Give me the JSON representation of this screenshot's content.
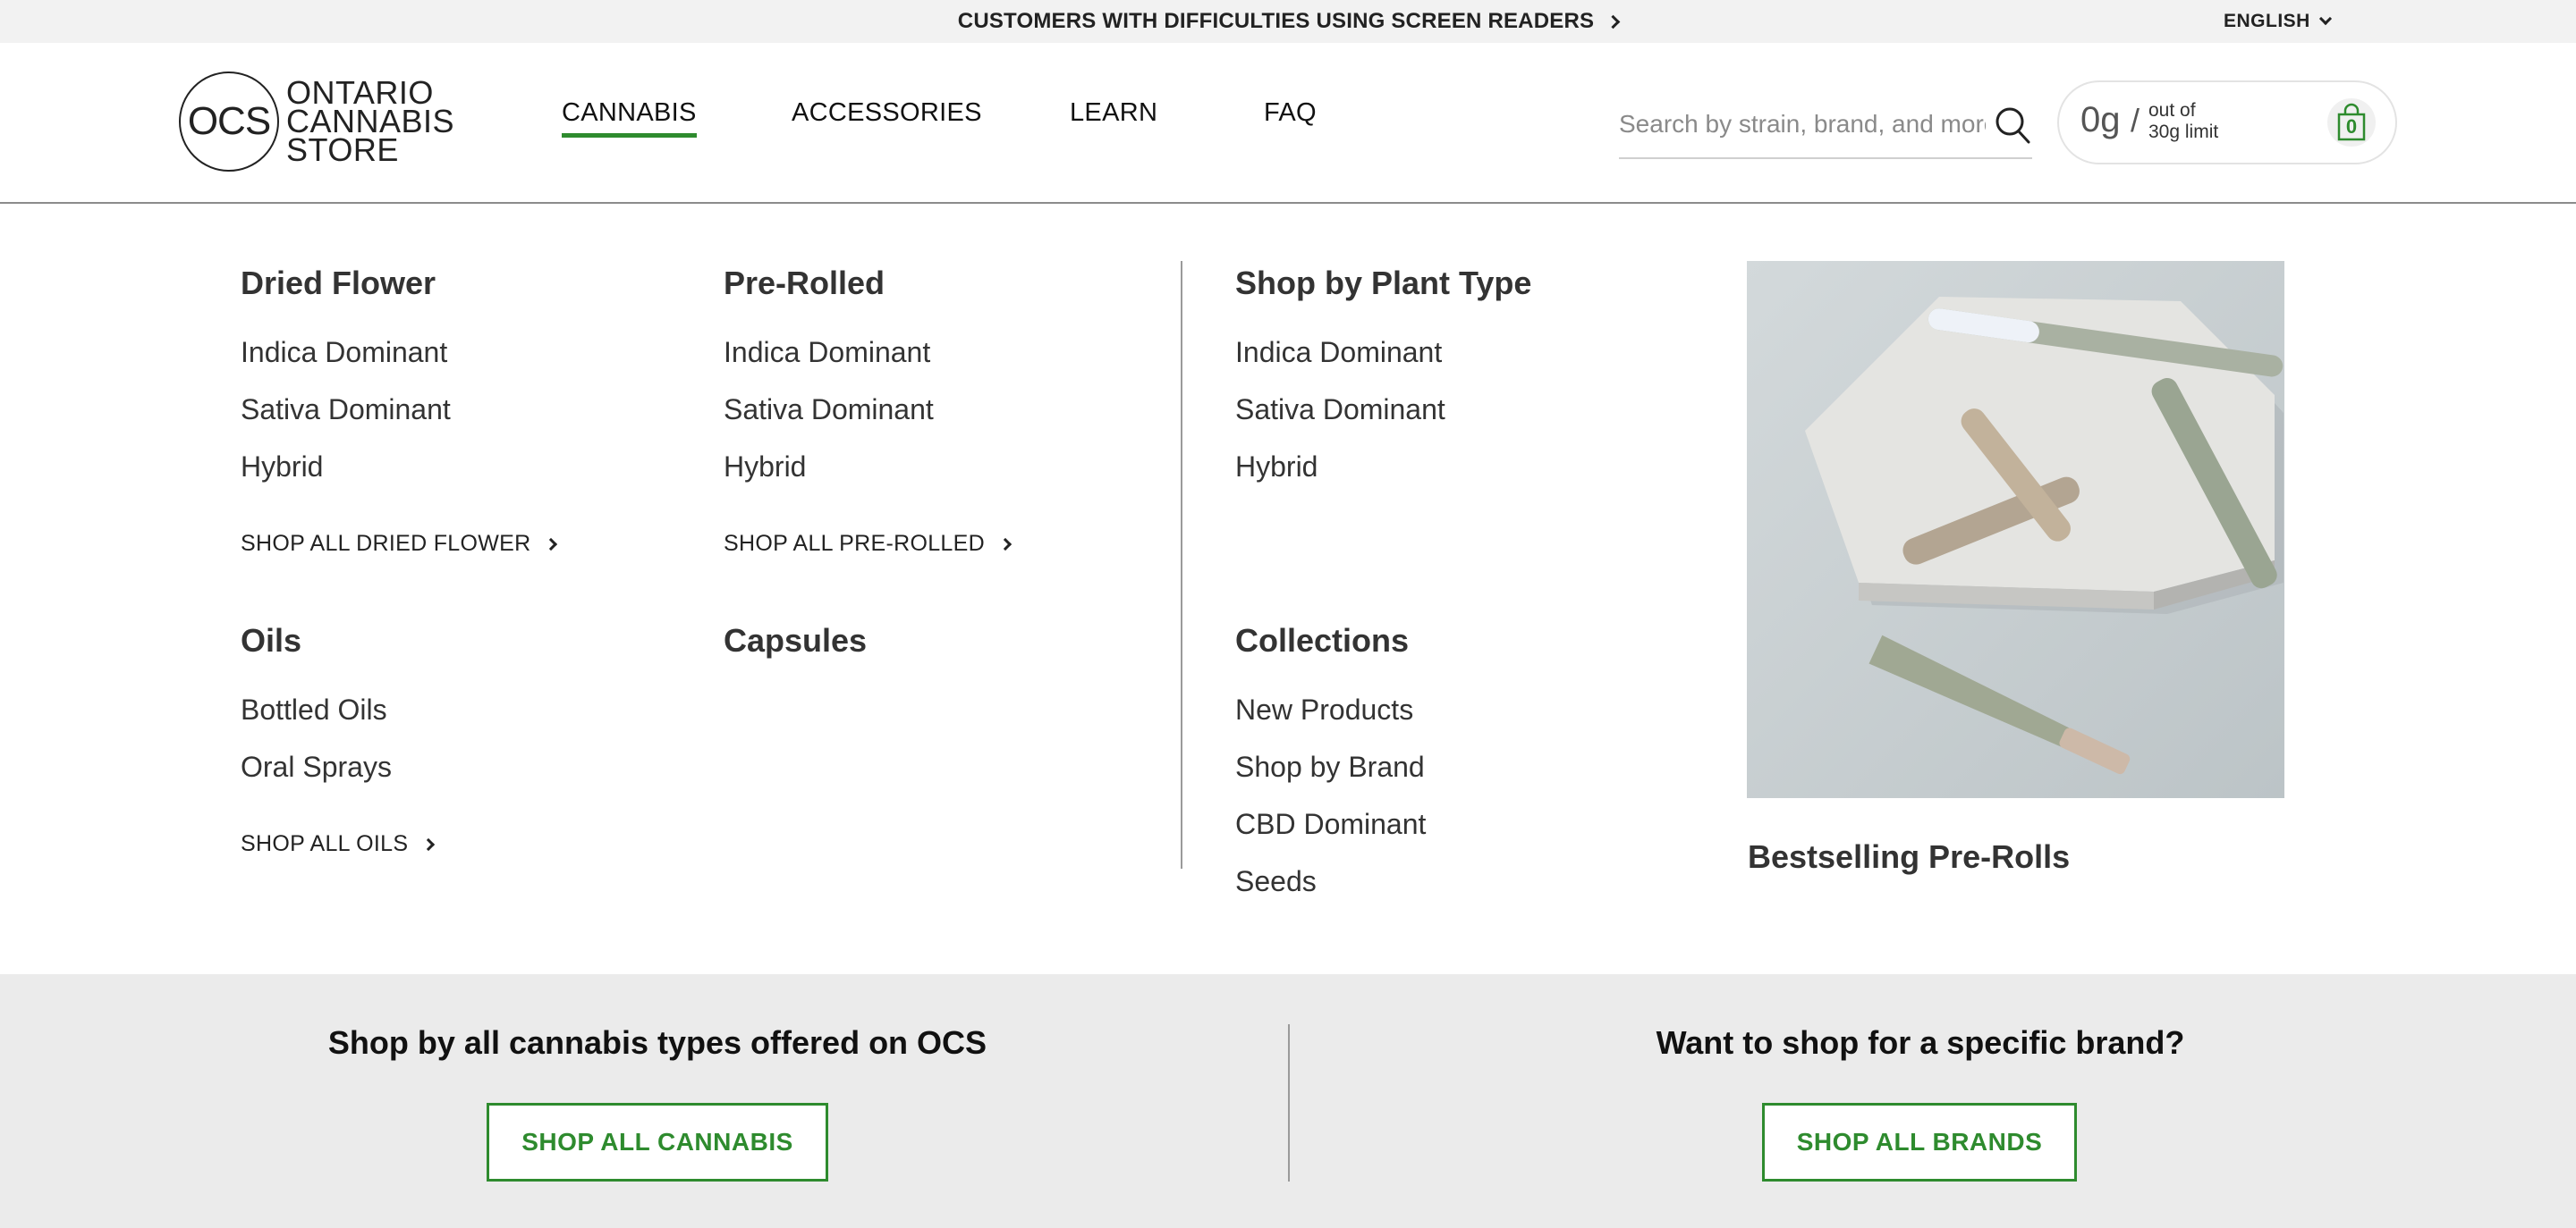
{
  "topbar": {
    "accessibility_link": "CUSTOMERS WITH DIFFICULTIES USING SCREEN READERS",
    "language": "ENGLISH"
  },
  "header": {
    "logo": {
      "monogram": "OCS",
      "line1": "ONTARIO",
      "line2": "CANNABIS",
      "line3": "STORE"
    },
    "nav": [
      {
        "label": "CANNABIS",
        "active": true
      },
      {
        "label": "ACCESSORIES",
        "active": false
      },
      {
        "label": "LEARN",
        "active": false
      },
      {
        "label": "FAQ",
        "active": false
      }
    ],
    "search": {
      "placeholder": "Search by strain, brand, and more",
      "value": ""
    },
    "cart": {
      "grams": "0g",
      "slash": "/",
      "limit_line1": "out of",
      "limit_line2": "30g limit",
      "count": "0"
    }
  },
  "menu": {
    "dried_flower": {
      "title": "Dried Flower",
      "links": [
        "Indica Dominant",
        "Sativa Dominant",
        "Hybrid"
      ],
      "shop_all": "SHOP ALL DRIED FLOWER"
    },
    "pre_rolled": {
      "title": "Pre-Rolled",
      "links": [
        "Indica Dominant",
        "Sativa Dominant",
        "Hybrid"
      ],
      "shop_all": "SHOP ALL PRE-ROLLED"
    },
    "oils": {
      "title": "Oils",
      "links": [
        "Bottled Oils",
        "Oral Sprays"
      ],
      "shop_all": "SHOP ALL OILS"
    },
    "capsules": {
      "title": "Capsules"
    },
    "plant_type": {
      "title": "Shop by Plant Type",
      "links": [
        "Indica Dominant",
        "Sativa Dominant",
        "Hybrid"
      ]
    },
    "collections": {
      "title": "Collections",
      "links": [
        "New Products",
        "Shop by Brand",
        "CBD Dominant",
        "Seeds"
      ]
    },
    "promo": {
      "title": "Bestselling Pre-Rolls"
    }
  },
  "band": {
    "left_heading": "Shop by all cannabis types offered on OCS",
    "left_button": "SHOP ALL CANNABIS",
    "right_heading": "Want to shop for a specific brand?",
    "right_button": "SHOP ALL BRANDS"
  },
  "colors": {
    "accent_green": "#2e8b2e",
    "topbar_bg": "#f2f2f2",
    "band_bg": "#ebebeb"
  }
}
